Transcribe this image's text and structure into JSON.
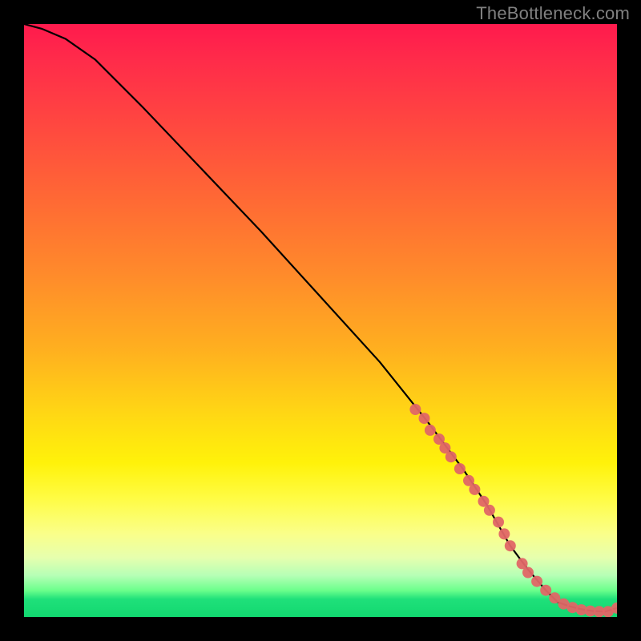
{
  "watermark": "TheBottleneck.com",
  "colors": {
    "background": "#000000",
    "curve": "#000000",
    "marker": "#e06666",
    "watermark": "#808080",
    "gradient_top": "#ff1a4d",
    "gradient_bottom": "#12d870"
  },
  "chart_data": {
    "type": "line",
    "title": "",
    "xlabel": "",
    "ylabel": "",
    "xlim": [
      0,
      100
    ],
    "ylim": [
      0,
      100
    ],
    "curve": {
      "x": [
        0,
        3,
        7,
        12,
        20,
        30,
        40,
        50,
        60,
        68,
        74,
        78,
        82,
        85,
        88,
        90,
        92,
        94,
        96,
        98,
        100
      ],
      "y": [
        100,
        99.2,
        97.5,
        94,
        86,
        75.5,
        65,
        54,
        43,
        33,
        25,
        19,
        12,
        8,
        4.5,
        2.5,
        1.8,
        1.3,
        1.0,
        0.9,
        1.5
      ]
    },
    "series": [
      {
        "name": "markers",
        "type": "scatter",
        "x": [
          66,
          67.5,
          68.5,
          70,
          71,
          72,
          73.5,
          75,
          76,
          77.5,
          78.5,
          80,
          81,
          82,
          84,
          85,
          86.5,
          88,
          89.5,
          91,
          92.5,
          94,
          95.5,
          97,
          98.5,
          100
        ],
        "y": [
          35,
          33.5,
          31.5,
          30,
          28.5,
          27,
          25,
          23,
          21.5,
          19.5,
          18,
          16,
          14,
          12,
          9,
          7.5,
          6,
          4.5,
          3.2,
          2.2,
          1.6,
          1.2,
          1.0,
          0.9,
          0.9,
          1.5
        ]
      }
    ],
    "grid": false,
    "legend": false,
    "notes": "Axes unlabeled; values normalized 0–100. Gradient background encodes score from red (bad, top) to green (good, bottom). Curve descends from top-left, flattens near bottom-right. Salmon markers cluster along lower-right segment of curve."
  }
}
